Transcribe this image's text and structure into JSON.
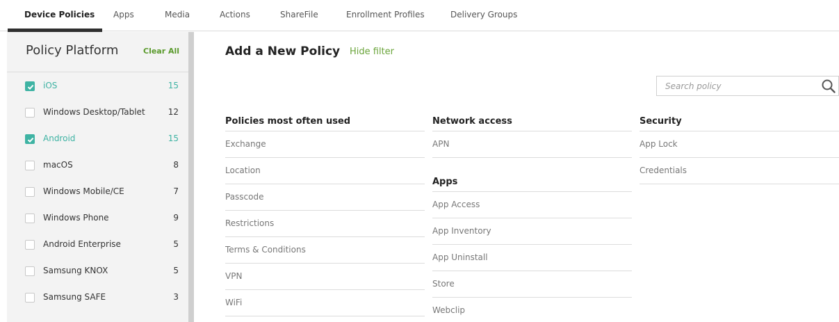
{
  "tabs": [
    {
      "label": "Device Policies",
      "active": true
    },
    {
      "label": "Apps",
      "active": false
    },
    {
      "label": "Media",
      "active": false
    },
    {
      "label": "Actions",
      "active": false
    },
    {
      "label": "ShareFile",
      "active": false
    },
    {
      "label": "Enrollment Profiles",
      "active": false
    },
    {
      "label": "Delivery Groups",
      "active": false
    }
  ],
  "sidebar": {
    "title": "Policy Platform",
    "clear_label": "Clear All",
    "items": [
      {
        "label": "iOS",
        "count": "15",
        "checked": true
      },
      {
        "label": "Windows Desktop/Tablet",
        "count": "12",
        "checked": false
      },
      {
        "label": "Android",
        "count": "15",
        "checked": true
      },
      {
        "label": "macOS",
        "count": "8",
        "checked": false
      },
      {
        "label": "Windows Mobile/CE",
        "count": "7",
        "checked": false
      },
      {
        "label": "Windows Phone",
        "count": "9",
        "checked": false
      },
      {
        "label": "Android Enterprise",
        "count": "5",
        "checked": false
      },
      {
        "label": "Samsung KNOX",
        "count": "5",
        "checked": false
      },
      {
        "label": "Samsung SAFE",
        "count": "3",
        "checked": false
      }
    ]
  },
  "main": {
    "title": "Add a New Policy",
    "hide_filter": "Hide filter",
    "search_placeholder": "Search policy",
    "columns": {
      "most_used": {
        "heading": "Policies most often used",
        "items": [
          "Exchange",
          "Location",
          "Passcode",
          "Restrictions",
          "Terms & Conditions",
          "VPN",
          "WiFi"
        ]
      },
      "network": {
        "heading": "Network access",
        "items": [
          "APN"
        ]
      },
      "apps": {
        "heading": "Apps",
        "items": [
          "App Access",
          "App Inventory",
          "App Uninstall",
          "Store",
          "Webclip"
        ]
      },
      "security": {
        "heading": "Security",
        "items": [
          "App Lock",
          "Credentials"
        ]
      }
    }
  },
  "colors": {
    "accent_green": "#6aa43a",
    "check_teal": "#3eb3a3"
  }
}
